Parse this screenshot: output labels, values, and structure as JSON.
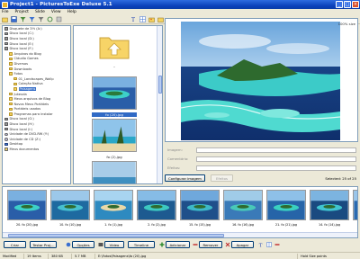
{
  "window": {
    "title": "Project1 - PicturesToExe Deluxe 5.1",
    "controls": [
      "_",
      "□",
      "×"
    ]
  },
  "menu": {
    "items": [
      "File",
      "Project",
      "Slide",
      "View",
      "Help"
    ]
  },
  "tree": {
    "items": [
      {
        "label": "Disquete de 3½ (A:)",
        "icon": "floppy-icon",
        "indent": 0
      },
      {
        "label": "Disco local (C:)",
        "icon": "drive-icon",
        "indent": 0
      },
      {
        "label": "Disco local (D:)",
        "icon": "drive-icon",
        "indent": 0
      },
      {
        "label": "Disco local (E:)",
        "icon": "drive-icon",
        "indent": 0
      },
      {
        "label": "Disco local (F:)",
        "icon": "drive-icon",
        "indent": 0
      },
      {
        "label": "Arquivos do Blog",
        "icon": "folder-icon",
        "indent": 1
      },
      {
        "label": "Cláudio Gomes",
        "icon": "folder-icon",
        "indent": 1
      },
      {
        "label": "Diversos",
        "icon": "folder-icon",
        "indent": 1
      },
      {
        "label": "Downloads",
        "icon": "folder-icon",
        "indent": 1
      },
      {
        "label": "Fotos",
        "icon": "folder-icon",
        "indent": 1
      },
      {
        "label": "01_Landscapes_Wallp",
        "icon": "folder-icon",
        "indent": 2
      },
      {
        "label": "Coleção Nativa",
        "icon": "folder-icon",
        "indent": 2
      },
      {
        "label": "Paisagens",
        "icon": "folder-icon",
        "indent": 2,
        "selected": true
      },
      {
        "label": "Jukeuda",
        "icon": "folder-icon",
        "indent": 1
      },
      {
        "label": "Meus arquivos de Blog",
        "icon": "folder-icon",
        "indent": 1
      },
      {
        "label": "Novos Meus Portáteis",
        "icon": "folder-icon",
        "indent": 1
      },
      {
        "label": "Portáteis usados",
        "icon": "folder-icon",
        "indent": 1
      },
      {
        "label": "Programas para instalar",
        "icon": "folder-icon",
        "indent": 1
      },
      {
        "label": "Disco local (G:)",
        "icon": "drive-icon",
        "indent": 0
      },
      {
        "label": "Disco local (H:)",
        "icon": "drive-icon",
        "indent": 0
      },
      {
        "label": "Disco local (I:)",
        "icon": "drive-icon",
        "indent": 0
      },
      {
        "label": "Unidade de DVD-RW (Y:)",
        "icon": "cd-icon",
        "indent": 0
      },
      {
        "label": "Unidade de CD (Z:)",
        "icon": "cd-icon",
        "indent": 0
      },
      {
        "label": "Desktop",
        "icon": "desktop-icon",
        "indent": 0
      },
      {
        "label": "Meus documentos",
        "icon": "docs-icon",
        "indent": 0
      }
    ]
  },
  "thumbs": {
    "up_label": "..",
    "items": [
      {
        "label": "fo (20).jpg",
        "selected": true
      },
      {
        "label": "fo (2).jpg",
        "selected": false
      },
      {
        "label": "",
        "selected": false
      }
    ]
  },
  "preview": {
    "zoom": "100% size"
  },
  "fields": {
    "labels": [
      "Imagem:",
      "Comentário:",
      "Efeitos:"
    ],
    "configure_button": "Configurar imagem",
    "effects_button": "Efeitos",
    "selected_count": "Selected: 25 of 25"
  },
  "strip": {
    "items": [
      "20. fo (20).jpg",
      "10. fo (10).jpg",
      "1. fo (1).jpg",
      "2. fo (2).jpg",
      "15. fo (15).jpg",
      "16. fo (16).jpg",
      "21. fo (21).jpg",
      "14. fo (14).jpg",
      "18. fo (18).jpg"
    ]
  },
  "actions": {
    "buttons": [
      "Criar",
      "Testar Proj...",
      "Opções",
      "Vídeo",
      "Timeline",
      "Adicionar",
      "Remover",
      "Apagar"
    ]
  },
  "status": {
    "segments": [
      "Modified",
      "19 Items",
      "380 KB",
      "5.7 MB",
      "E:\\Fotos\\Paisagens\\fo (20).jpg",
      "Hold Size points"
    ]
  }
}
